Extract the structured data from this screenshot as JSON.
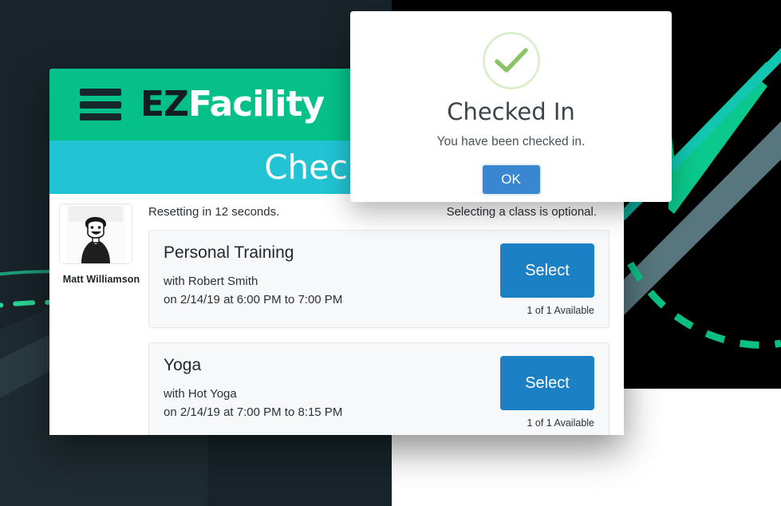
{
  "app": {
    "logo_ez": "EZ",
    "logo_facility": "Facility",
    "menu_icon": "hamburger-menu-icon",
    "page_title": "Check In"
  },
  "user": {
    "name": "Matt Williamson",
    "avatar_alt": "user-photo"
  },
  "status": {
    "reset_text": "Resetting in 12 seconds.",
    "optional_text": "Selecting a class is optional."
  },
  "classes": [
    {
      "name": "Personal Training",
      "instructor": "with Robert Smith",
      "schedule": "on 2/14/19 at 6:00 PM to 7:00 PM",
      "button_label": "Select",
      "availability": "1 of 1 Available"
    },
    {
      "name": "Yoga",
      "instructor": "with Hot Yoga",
      "schedule": "on 2/14/19 at 7:00 PM to 8:15 PM",
      "button_label": "Select",
      "availability": "1 of 1 Available"
    }
  ],
  "modal": {
    "icon": "check-circle-icon",
    "title": "Checked In",
    "message": "You have been checked in.",
    "ok_label": "OK"
  },
  "colors": {
    "header_green": "#05c189",
    "subheader_teal": "#22c4d3",
    "select_blue": "#1b80c4",
    "ok_blue": "#3b86d1",
    "check_green": "#8ac465",
    "check_ring": "#dcefcd",
    "background_dark": "#18242a",
    "background_black": "#000000",
    "accent_green": "#0bc98c"
  }
}
